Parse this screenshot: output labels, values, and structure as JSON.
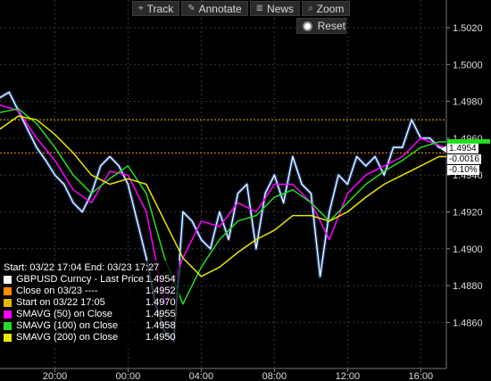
{
  "toolbar": {
    "items": [
      {
        "label": "Track",
        "icon": "crosshair-icon",
        "glyph": "⌖"
      },
      {
        "label": "Annotate",
        "icon": "pencil-icon",
        "glyph": "✎"
      },
      {
        "label": "News",
        "icon": "news-icon",
        "glyph": "≣"
      },
      {
        "label": "Zoom",
        "icon": "magnifier-icon",
        "glyph": "⌕"
      }
    ],
    "reset_label": "Reset"
  },
  "legend": {
    "range_text": "Start: 03/22 17:04 End: 03/23 17:27",
    "rows": [
      {
        "label": "GBPUSD Curncy - Last Price",
        "value": "1.4954",
        "color": "#ffffff"
      },
      {
        "label": "Close on 03/23 ----",
        "value": "1.4952",
        "color": "#ff8c00"
      },
      {
        "label": "Start on 03/22 17:05",
        "value": "1.4970",
        "color": "#e6b800"
      },
      {
        "label": "SMAVG (50) on Close",
        "value": "1.4955",
        "color": "#ff00ff"
      },
      {
        "label": "SMAVG (100) on Close",
        "value": "1.4958",
        "color": "#22dd22"
      },
      {
        "label": "SMAVG (200) on Close",
        "value": "1.4950",
        "color": "#e8e800"
      }
    ]
  },
  "right_labels": {
    "last_price": "1.4954",
    "change": "-0.0016",
    "change_pct": "-0.10%"
  },
  "chart_data": {
    "type": "line",
    "ylim": [
      1.4835,
      1.5035
    ],
    "y_ticks": [
      "1.5020",
      "1.5000",
      "1.4980",
      "1.4960",
      "1.4940",
      "1.4920",
      "1.4900",
      "1.4880",
      "1.4860"
    ],
    "x_ticks": [
      "20:00",
      "00:00",
      "04:00",
      "08:00",
      "12:00",
      "16:00"
    ],
    "x_hours": [
      3,
      7,
      11,
      15,
      19,
      23
    ],
    "x_range_hours": [
      0,
      24.4
    ],
    "reference_lines": [
      {
        "name": "Start on 03/22 17:05",
        "value": 1.497,
        "color": "#e6b800"
      },
      {
        "name": "Close on 03/23",
        "value": 1.4952,
        "color": "#ff8c00"
      }
    ],
    "series": [
      {
        "name": "GBPUSD Curncy - Last Price",
        "color": "#ffffff",
        "x": [
          0,
          0.5,
          1,
          1.5,
          2,
          2.5,
          3,
          3.5,
          4,
          4.5,
          5,
          5.5,
          6,
          6.5,
          7,
          7.5,
          8,
          8.5,
          9,
          9.5,
          10,
          10.5,
          11,
          11.5,
          12,
          12.5,
          13,
          13.5,
          14,
          14.5,
          15,
          15.5,
          16,
          16.5,
          17,
          17.5,
          18,
          18.5,
          19,
          19.5,
          20,
          20.5,
          21,
          21.5,
          22,
          22.5,
          23,
          23.5,
          24,
          24.4
        ],
        "y": [
          1.4982,
          1.4985,
          1.4975,
          1.4965,
          1.4955,
          1.4948,
          1.494,
          1.4935,
          1.4925,
          1.492,
          1.493,
          1.4945,
          1.495,
          1.4945,
          1.4935,
          1.4915,
          1.4895,
          1.487,
          1.4855,
          1.485,
          1.492,
          1.4915,
          1.4905,
          1.49,
          1.492,
          1.4905,
          1.493,
          1.4935,
          1.49,
          1.493,
          1.494,
          1.4925,
          1.495,
          1.4935,
          1.493,
          1.4885,
          1.492,
          1.494,
          1.4935,
          1.495,
          1.4945,
          1.495,
          1.494,
          1.4955,
          1.4955,
          1.497,
          1.496,
          1.496,
          1.4955,
          1.4954
        ]
      },
      {
        "name": "SMAVG (50) on Close",
        "color": "#ff00ff",
        "x": [
          0,
          1,
          2,
          3,
          4,
          5,
          6,
          7,
          8,
          9,
          10,
          11,
          12,
          13,
          14,
          15,
          16,
          17,
          18,
          19,
          20,
          21,
          22,
          23,
          24,
          24.4
        ],
        "y": [
          1.4978,
          1.4975,
          1.496,
          1.4948,
          1.4932,
          1.4925,
          1.4942,
          1.494,
          1.492,
          1.487,
          1.4895,
          1.4915,
          1.4912,
          1.4925,
          1.492,
          1.4935,
          1.4935,
          1.4925,
          1.4905,
          1.493,
          1.494,
          1.4945,
          1.495,
          1.496,
          1.4956,
          1.4955
        ]
      },
      {
        "name": "SMAVG (100) on Close",
        "color": "#22dd22",
        "x": [
          0,
          1,
          2,
          3,
          4,
          5,
          6,
          7,
          8,
          9,
          10,
          11,
          12,
          13,
          14,
          15,
          16,
          17,
          18,
          19,
          20,
          21,
          22,
          23,
          24,
          24.4
        ],
        "y": [
          1.4974,
          1.4976,
          1.4968,
          1.4955,
          1.494,
          1.493,
          1.4938,
          1.4945,
          1.493,
          1.4895,
          1.487,
          1.489,
          1.4905,
          1.4915,
          1.4918,
          1.4928,
          1.4932,
          1.4925,
          1.4915,
          1.4925,
          1.4935,
          1.4942,
          1.4948,
          1.4955,
          1.4958,
          1.4958
        ]
      },
      {
        "name": "SMAVG (200) on Close",
        "color": "#e8e800",
        "x": [
          0,
          1,
          2,
          3,
          4,
          5,
          6,
          7,
          8,
          9,
          10,
          11,
          12,
          13,
          14,
          15,
          16,
          17,
          18,
          19,
          20,
          21,
          22,
          23,
          24,
          24.4
        ],
        "y": [
          1.4965,
          1.4972,
          1.497,
          1.4962,
          1.4952,
          1.494,
          1.4935,
          1.4938,
          1.4935,
          1.4915,
          1.4895,
          1.4885,
          1.489,
          1.4898,
          1.4905,
          1.491,
          1.4918,
          1.4918,
          1.4915,
          1.492,
          1.4928,
          1.4935,
          1.494,
          1.4945,
          1.495,
          1.495
        ]
      }
    ]
  }
}
